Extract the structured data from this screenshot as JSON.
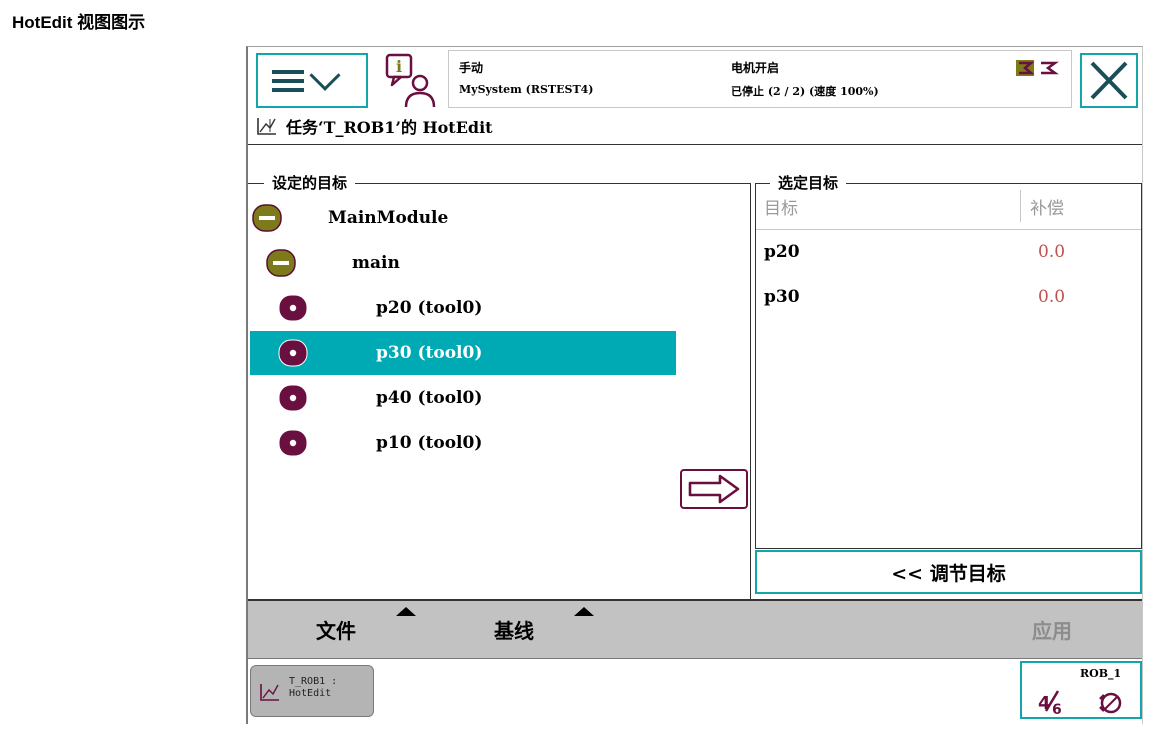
{
  "caption": "HotEdit 视图图示",
  "status": {
    "mode": "手动",
    "system": "MySystem (RSTEST4)",
    "motor": "电机开启",
    "state": "已停止 (2 / 2) (速度 100%)"
  },
  "window_title": "任务‘T_ROB1’的 HotEdit",
  "left_pane": {
    "legend": "设定的目标",
    "tree": [
      {
        "label": "MainModule",
        "level": 0,
        "type": "module",
        "selected": false
      },
      {
        "label": "main",
        "level": 1,
        "type": "routine",
        "selected": false
      },
      {
        "label": "p20 (tool0)",
        "level": 2,
        "type": "target",
        "selected": false
      },
      {
        "label": "p30 (tool0)",
        "level": 2,
        "type": "target",
        "selected": true
      },
      {
        "label": "p40 (tool0)",
        "level": 2,
        "type": "target",
        "selected": false
      },
      {
        "label": "p10 (tool0)",
        "level": 2,
        "type": "target",
        "selected": false
      }
    ]
  },
  "right_pane": {
    "legend": "选定目标",
    "columns": [
      "目标",
      "补偿"
    ],
    "rows": [
      {
        "target": "p20",
        "offset": "0.0"
      },
      {
        "target": "p30",
        "offset": "0.0"
      }
    ],
    "adjust_button": "<< 调节目标"
  },
  "command_bar": {
    "file": "文件",
    "baseline": "基线",
    "apply": "应用"
  },
  "taskbar": {
    "task_label": "T_ROB1 :\nHotEdit",
    "rob_label": "ROB_1"
  },
  "colors": {
    "selection": "#00aab4",
    "accent": "#14a5aa",
    "node_module": "#7c7a1a",
    "node_target": "#6a1040",
    "offset_value": "#c0504d"
  },
  "icons": {
    "menu": "hamburger-icon",
    "info": "info-person-icon",
    "close": "close-icon",
    "arrow": "right-arrow-icon",
    "jog": "jog-icon"
  }
}
